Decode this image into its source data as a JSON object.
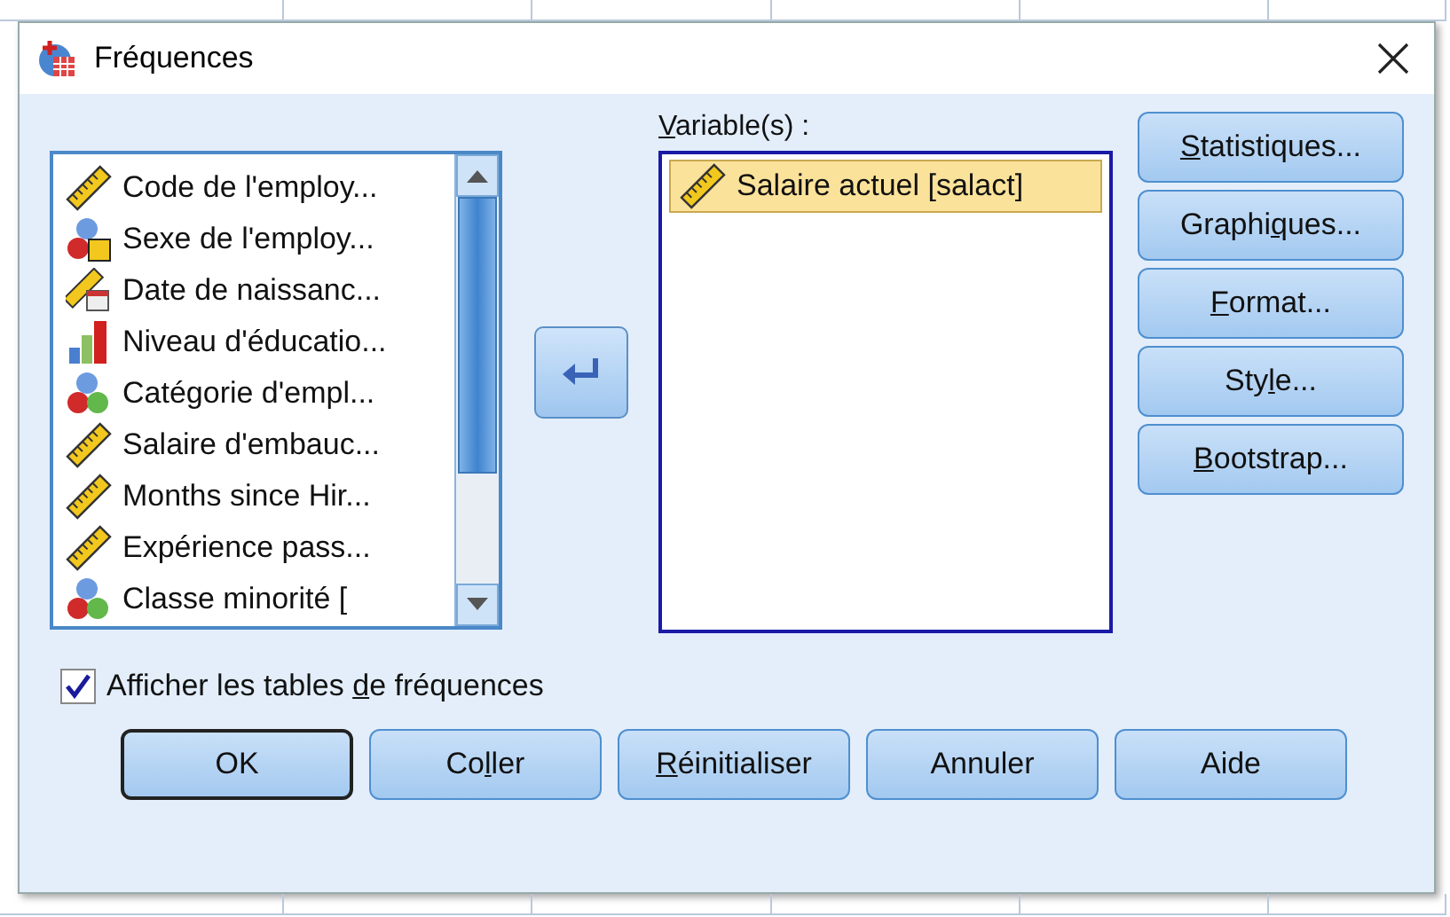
{
  "window": {
    "title": "Fréquences"
  },
  "source_list": {
    "items": [
      {
        "label": "Code de l'employ...",
        "kind": "scale",
        "selected": false
      },
      {
        "label": "Sexe de l'employ...",
        "kind": "nominal_string",
        "selected": false
      },
      {
        "label": "Date de naissanc...",
        "kind": "date",
        "selected": false
      },
      {
        "label": "Niveau d'éducatio...",
        "kind": "ordinal",
        "selected": false
      },
      {
        "label": "Catégorie d'empl...",
        "kind": "nominal",
        "selected": false
      },
      {
        "label": "Salaire d'embauc...",
        "kind": "scale",
        "selected": false
      },
      {
        "label": "Months since Hir...",
        "kind": "scale",
        "selected": false
      },
      {
        "label": "Expérience pass...",
        "kind": "scale",
        "selected": false
      },
      {
        "label": "Classe minorité [",
        "kind": "nominal",
        "selected": false
      }
    ]
  },
  "variables": {
    "label": {
      "key": "V",
      "after": "ariable(s) :"
    },
    "items": [
      {
        "label": "Salaire actuel [salact]",
        "kind": "scale",
        "selected": true
      }
    ]
  },
  "side_buttons": [
    {
      "key": "S",
      "after": "tatistiques..."
    },
    {
      "before": "Graphi",
      "key": "q",
      "after": "ues..."
    },
    {
      "key": "F",
      "after": "ormat..."
    },
    {
      "before": "Sty",
      "key": "l",
      "after": "e..."
    },
    {
      "key": "B",
      "after": "ootstrap..."
    }
  ],
  "show_tables": {
    "label": {
      "before": "Afficher les tables ",
      "key": "d",
      "after": "e fréquences"
    },
    "checked": true
  },
  "bottom_buttons": [
    {
      "before": "OK",
      "default": true
    },
    {
      "before": "Co",
      "key": "l",
      "after": "ler",
      "default": false
    },
    {
      "key": "R",
      "after": "éinitialiser",
      "default": false
    },
    {
      "before": "Annuler",
      "default": false
    },
    {
      "before": "Aide",
      "default": false
    }
  ]
}
